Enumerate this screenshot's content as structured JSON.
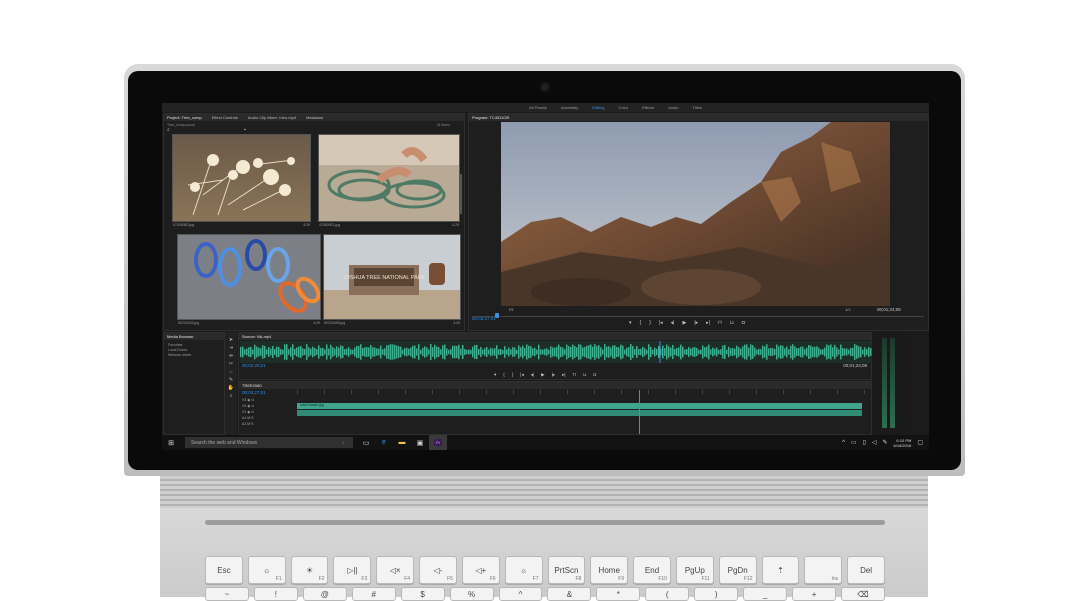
{
  "workspaces": [
    "All Panels",
    "Assembly",
    "Editing",
    "Color",
    "Effects",
    "Audio",
    "Titles"
  ],
  "active_workspace": "Editing",
  "project_panel": {
    "tabs": [
      "Project: Tree_comp",
      "Effect Controls",
      "Audio Clip Mixer: Intro.mp4",
      "Metadata"
    ],
    "path": "Tree_comp.prproj",
    "item_count": "24 Items",
    "thumbnails": [
      {
        "name": "07438382.jpg",
        "duration": "4:29"
      },
      {
        "name": "47583921.jpg",
        "duration": "4:29"
      },
      {
        "name": "80204233.jpg",
        "duration": "4:29"
      },
      {
        "name": "80203498.jpg",
        "duration": "4:29"
      }
    ]
  },
  "program_panel": {
    "title": "Program: TC4311OR",
    "timecode_in": "00;03;27;01",
    "fit": "Fit",
    "zoom": "1/2",
    "timecode_out": "00;01;24;08"
  },
  "sign_text": "JOSHUA TREE NATIONAL PARK",
  "media_browser": {
    "title": "Media Browser",
    "items": [
      "Favorites",
      "Local Drives",
      "Network drives"
    ]
  },
  "source_panel": {
    "title": "Source: NA.mp4",
    "timecode_in": "00;02;20;21",
    "timecode_out": "00;01;24;08"
  },
  "timeline_panel": {
    "title": "TREE2080",
    "timecode": "00;03;27;01",
    "clip_name": "Intro/Teaser.jpg"
  },
  "taskbar": {
    "search_placeholder": "Search the web and Windows",
    "time": "6:10 PM",
    "date": "6/16/2016"
  },
  "keyboard": {
    "row1": [
      {
        "label": "Esc",
        "fn": ""
      },
      {
        "label": "☼",
        "fn": "F1"
      },
      {
        "label": "☀",
        "fn": "F2"
      },
      {
        "label": "▷||",
        "fn": "F3"
      },
      {
        "label": "◁×",
        "fn": "F4"
      },
      {
        "label": "◁-",
        "fn": "F5"
      },
      {
        "label": "◁+",
        "fn": "F6"
      },
      {
        "label": "☼",
        "fn": "F7"
      },
      {
        "label": "PrtScn",
        "fn": "F8"
      },
      {
        "label": "Home",
        "fn": "F9"
      },
      {
        "label": "End",
        "fn": "F10"
      },
      {
        "label": "PgUp",
        "fn": "F11"
      },
      {
        "label": "PgDn",
        "fn": "F12"
      },
      {
        "label": "⇡",
        "fn": ""
      },
      {
        "label": "",
        "fn": "Ins"
      },
      {
        "label": "Del",
        "fn": ""
      }
    ],
    "row2": [
      "~",
      "!",
      "@",
      "#",
      "$",
      "%",
      "^",
      "&",
      "*",
      "(",
      ")",
      "_",
      "+",
      "⌫"
    ]
  }
}
